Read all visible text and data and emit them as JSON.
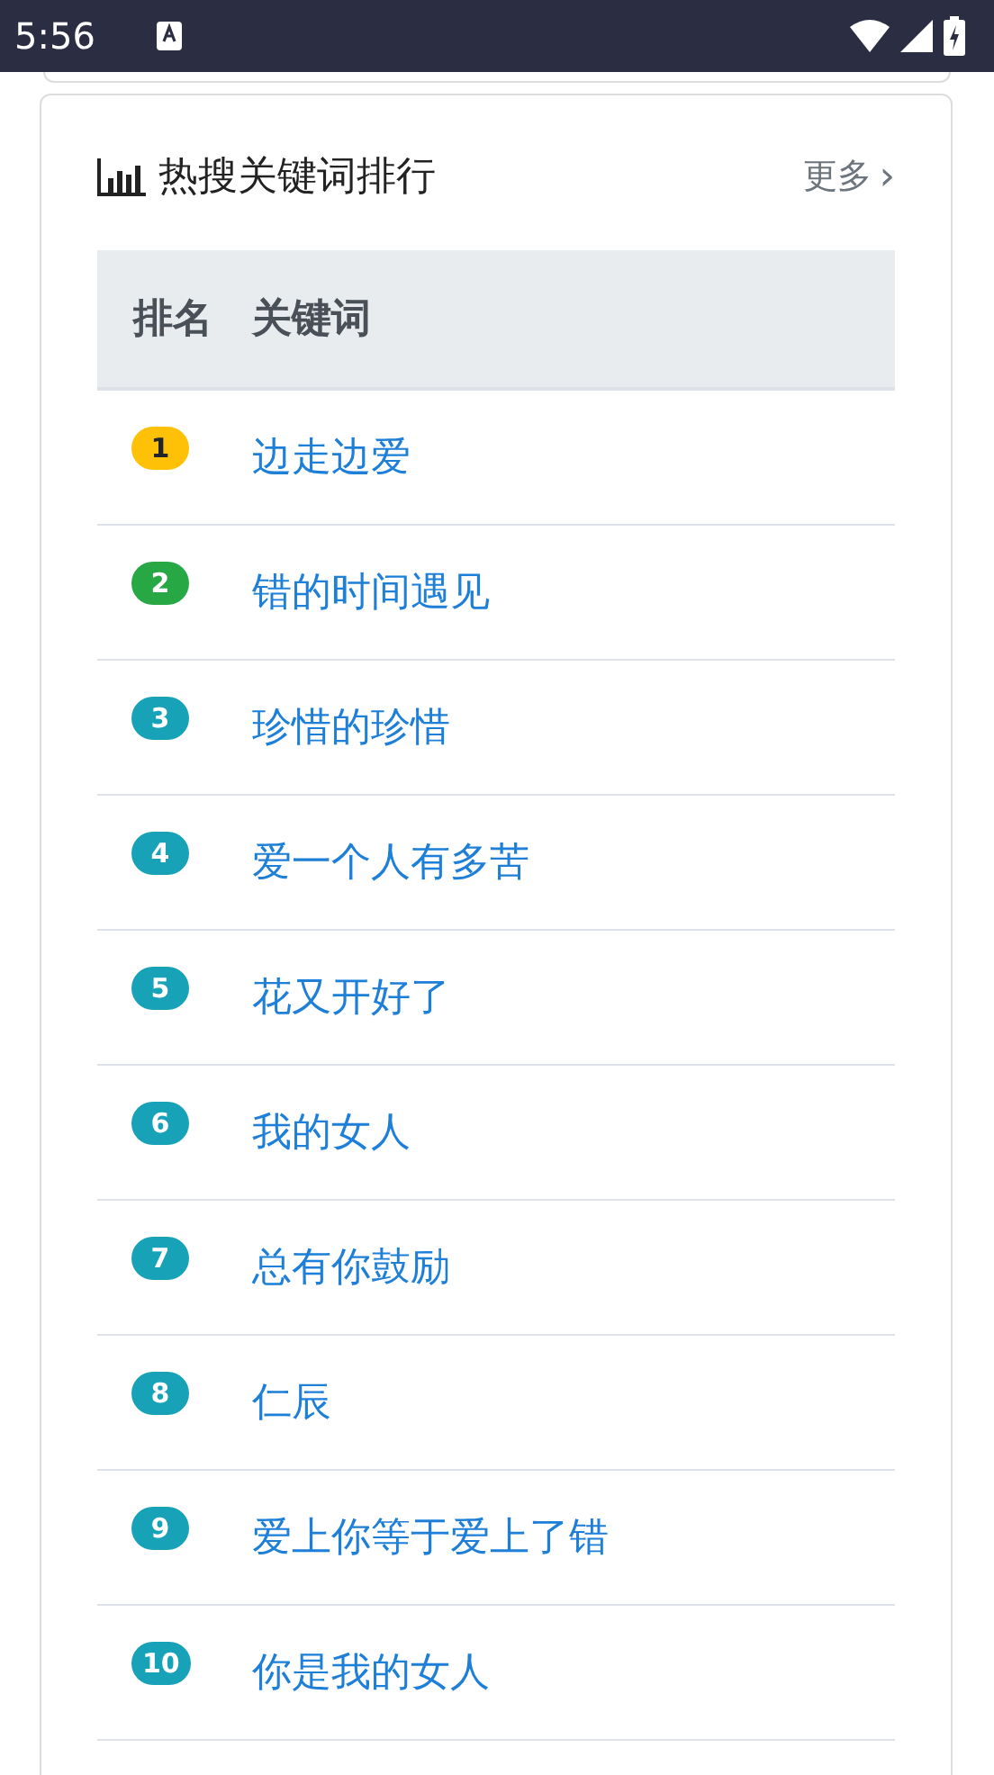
{
  "status_bar": {
    "time": "5:56"
  },
  "card": {
    "title": "热搜关键词排行",
    "more": "更多",
    "more_icon": "›"
  },
  "table": {
    "columns": [
      "排名",
      "关键词"
    ],
    "rows": [
      {
        "rank": "1",
        "keyword": "边走边爱",
        "color": "#ffc107"
      },
      {
        "rank": "2",
        "keyword": "错的时间遇见",
        "color": "#28a745"
      },
      {
        "rank": "3",
        "keyword": "珍惜的珍惜",
        "color": "#17a2b8"
      },
      {
        "rank": "4",
        "keyword": "爱一个人有多苦",
        "color": "#17a2b8"
      },
      {
        "rank": "5",
        "keyword": "花又开好了",
        "color": "#17a2b8"
      },
      {
        "rank": "6",
        "keyword": "我的女人",
        "color": "#17a2b8"
      },
      {
        "rank": "7",
        "keyword": "总有你鼓励",
        "color": "#17a2b8"
      },
      {
        "rank": "8",
        "keyword": "仁辰",
        "color": "#17a2b8"
      },
      {
        "rank": "9",
        "keyword": "爱上你等于爱上了错",
        "color": "#17a2b8"
      },
      {
        "rank": "10",
        "keyword": "你是我的女人",
        "color": "#17a2b8"
      }
    ]
  }
}
